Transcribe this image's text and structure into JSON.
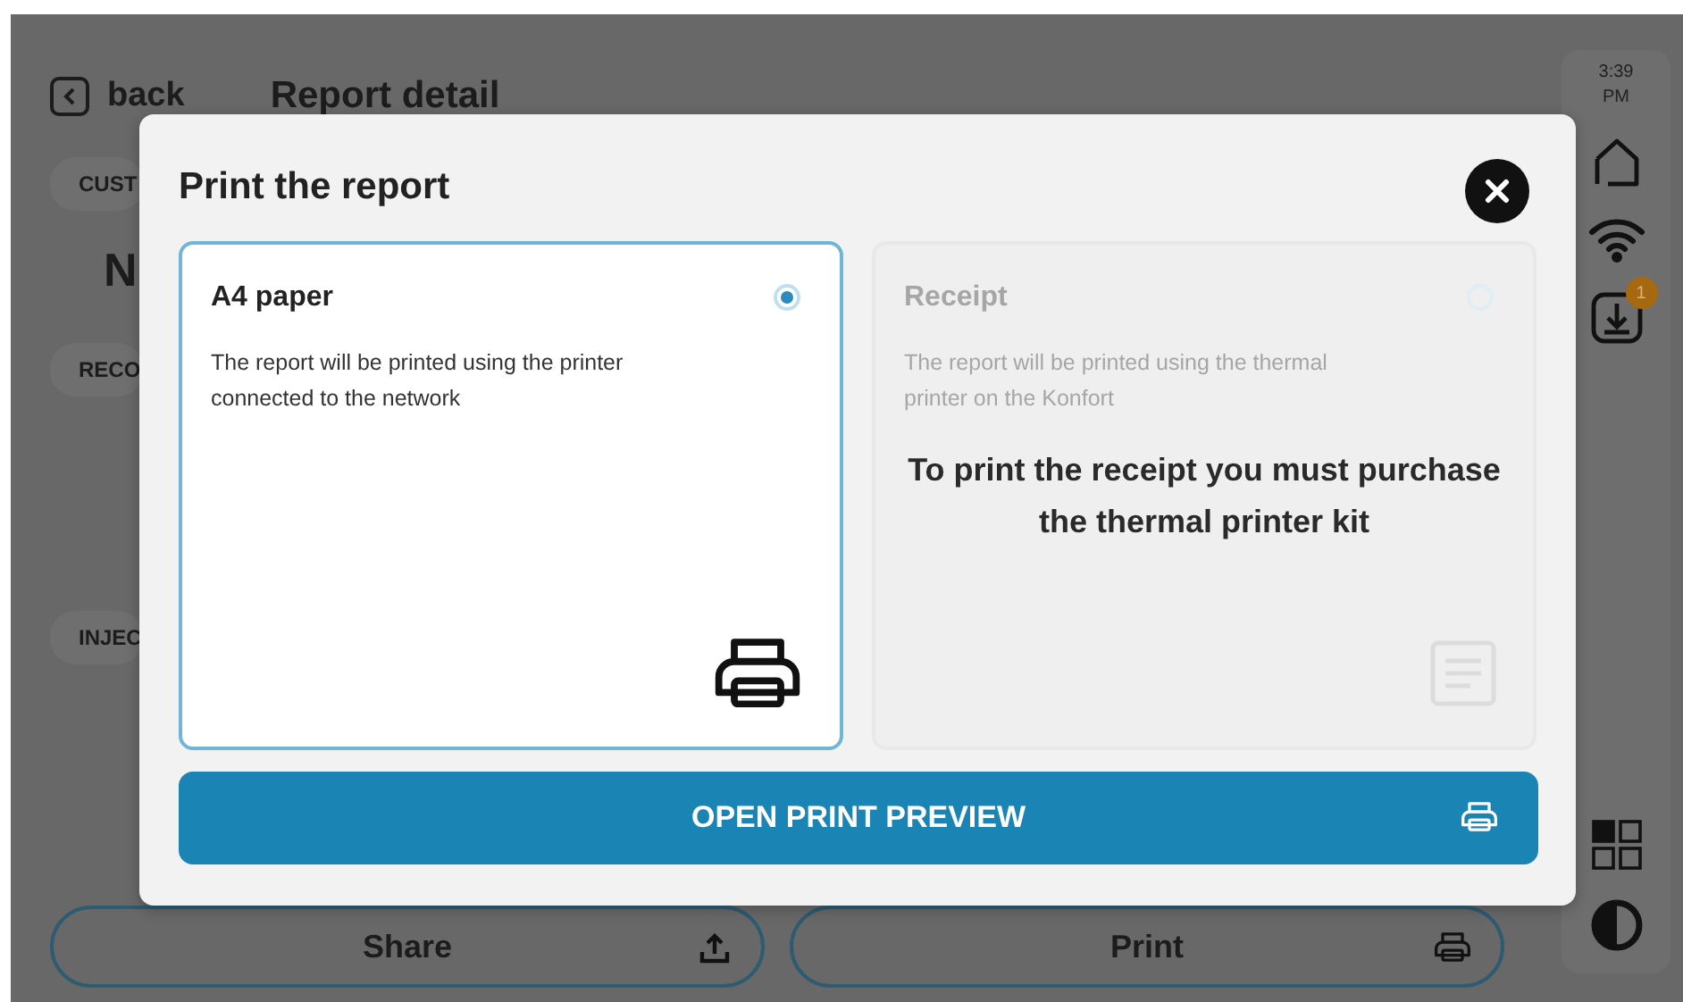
{
  "background": {
    "back_label": "back",
    "title": "Report detail",
    "chips": [
      {
        "label": "CUST"
      },
      {
        "label": "RECO"
      },
      {
        "label": "INJEC"
      }
    ],
    "heading_fragment": "N",
    "buttons": [
      {
        "label": "Share",
        "kind": "share"
      },
      {
        "label": "Print",
        "kind": "printer"
      }
    ]
  },
  "status_rail": {
    "time": "3:39 PM",
    "download_badge": "1"
  },
  "dialog": {
    "title": "Print the report",
    "options": [
      {
        "title": "A4 paper",
        "description": "The report will be printed using the printer connected to the network",
        "selected": true,
        "disabled": false,
        "kind": "printer"
      },
      {
        "title": "Receipt",
        "description": "The report will be printed using the thermal printer on the Konfort",
        "selected": false,
        "disabled": true,
        "kind": "receipt",
        "notice": "To print the receipt you must purchase the thermal printer kit"
      }
    ],
    "action": "OPEN PRINT PREVIEW"
  }
}
